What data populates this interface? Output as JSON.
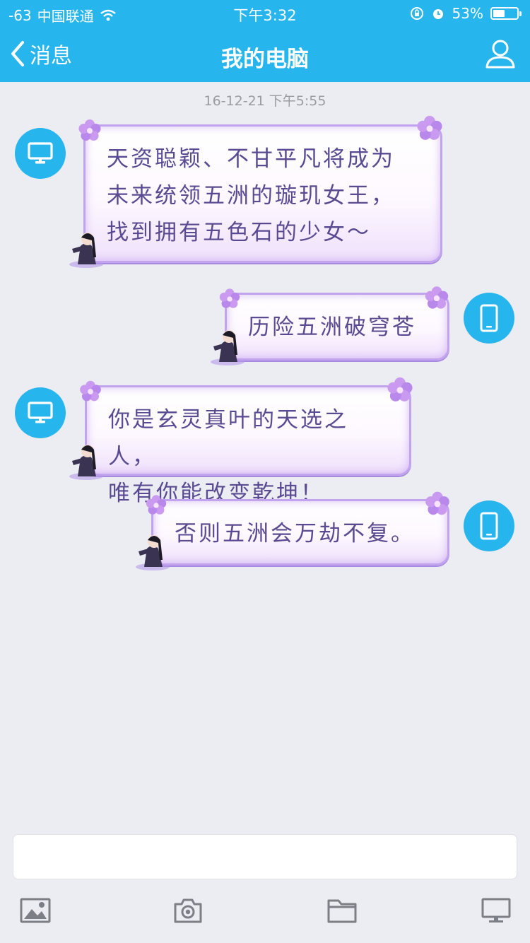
{
  "status": {
    "signal": "-63",
    "carrier": "中国联通",
    "time": "下午3:32",
    "battery": "53%",
    "battery_level": 0.53
  },
  "header": {
    "back_label": "消息",
    "title": "我的电脑"
  },
  "chat": {
    "timestamp": "16-12-21 下午5:55",
    "messages": [
      {
        "side": "left",
        "device": "computer-icon",
        "text": "天资聪颖、不甘平凡将成为\n未来统领五洲的璇玑女王，\n找到拥有五色石的少女～"
      },
      {
        "side": "right",
        "device": "phone-icon",
        "text": "历险五洲破穹苍"
      },
      {
        "side": "left",
        "device": "computer-icon",
        "text": "你是玄灵真叶的天选之人，\n唯有你能改变乾坤！"
      },
      {
        "side": "right",
        "device": "phone-icon",
        "text": "否则五洲会万劫不复。"
      }
    ]
  },
  "composer": {
    "placeholder": ""
  },
  "toolbar": {
    "items": [
      "image-icon",
      "camera-icon",
      "folder-icon",
      "computer-icon"
    ]
  },
  "colors": {
    "accent": "#27b5ee",
    "background": "#ebedf2",
    "bubble_border": "#c2a4ee",
    "bubble_text": "#5a4a92"
  }
}
